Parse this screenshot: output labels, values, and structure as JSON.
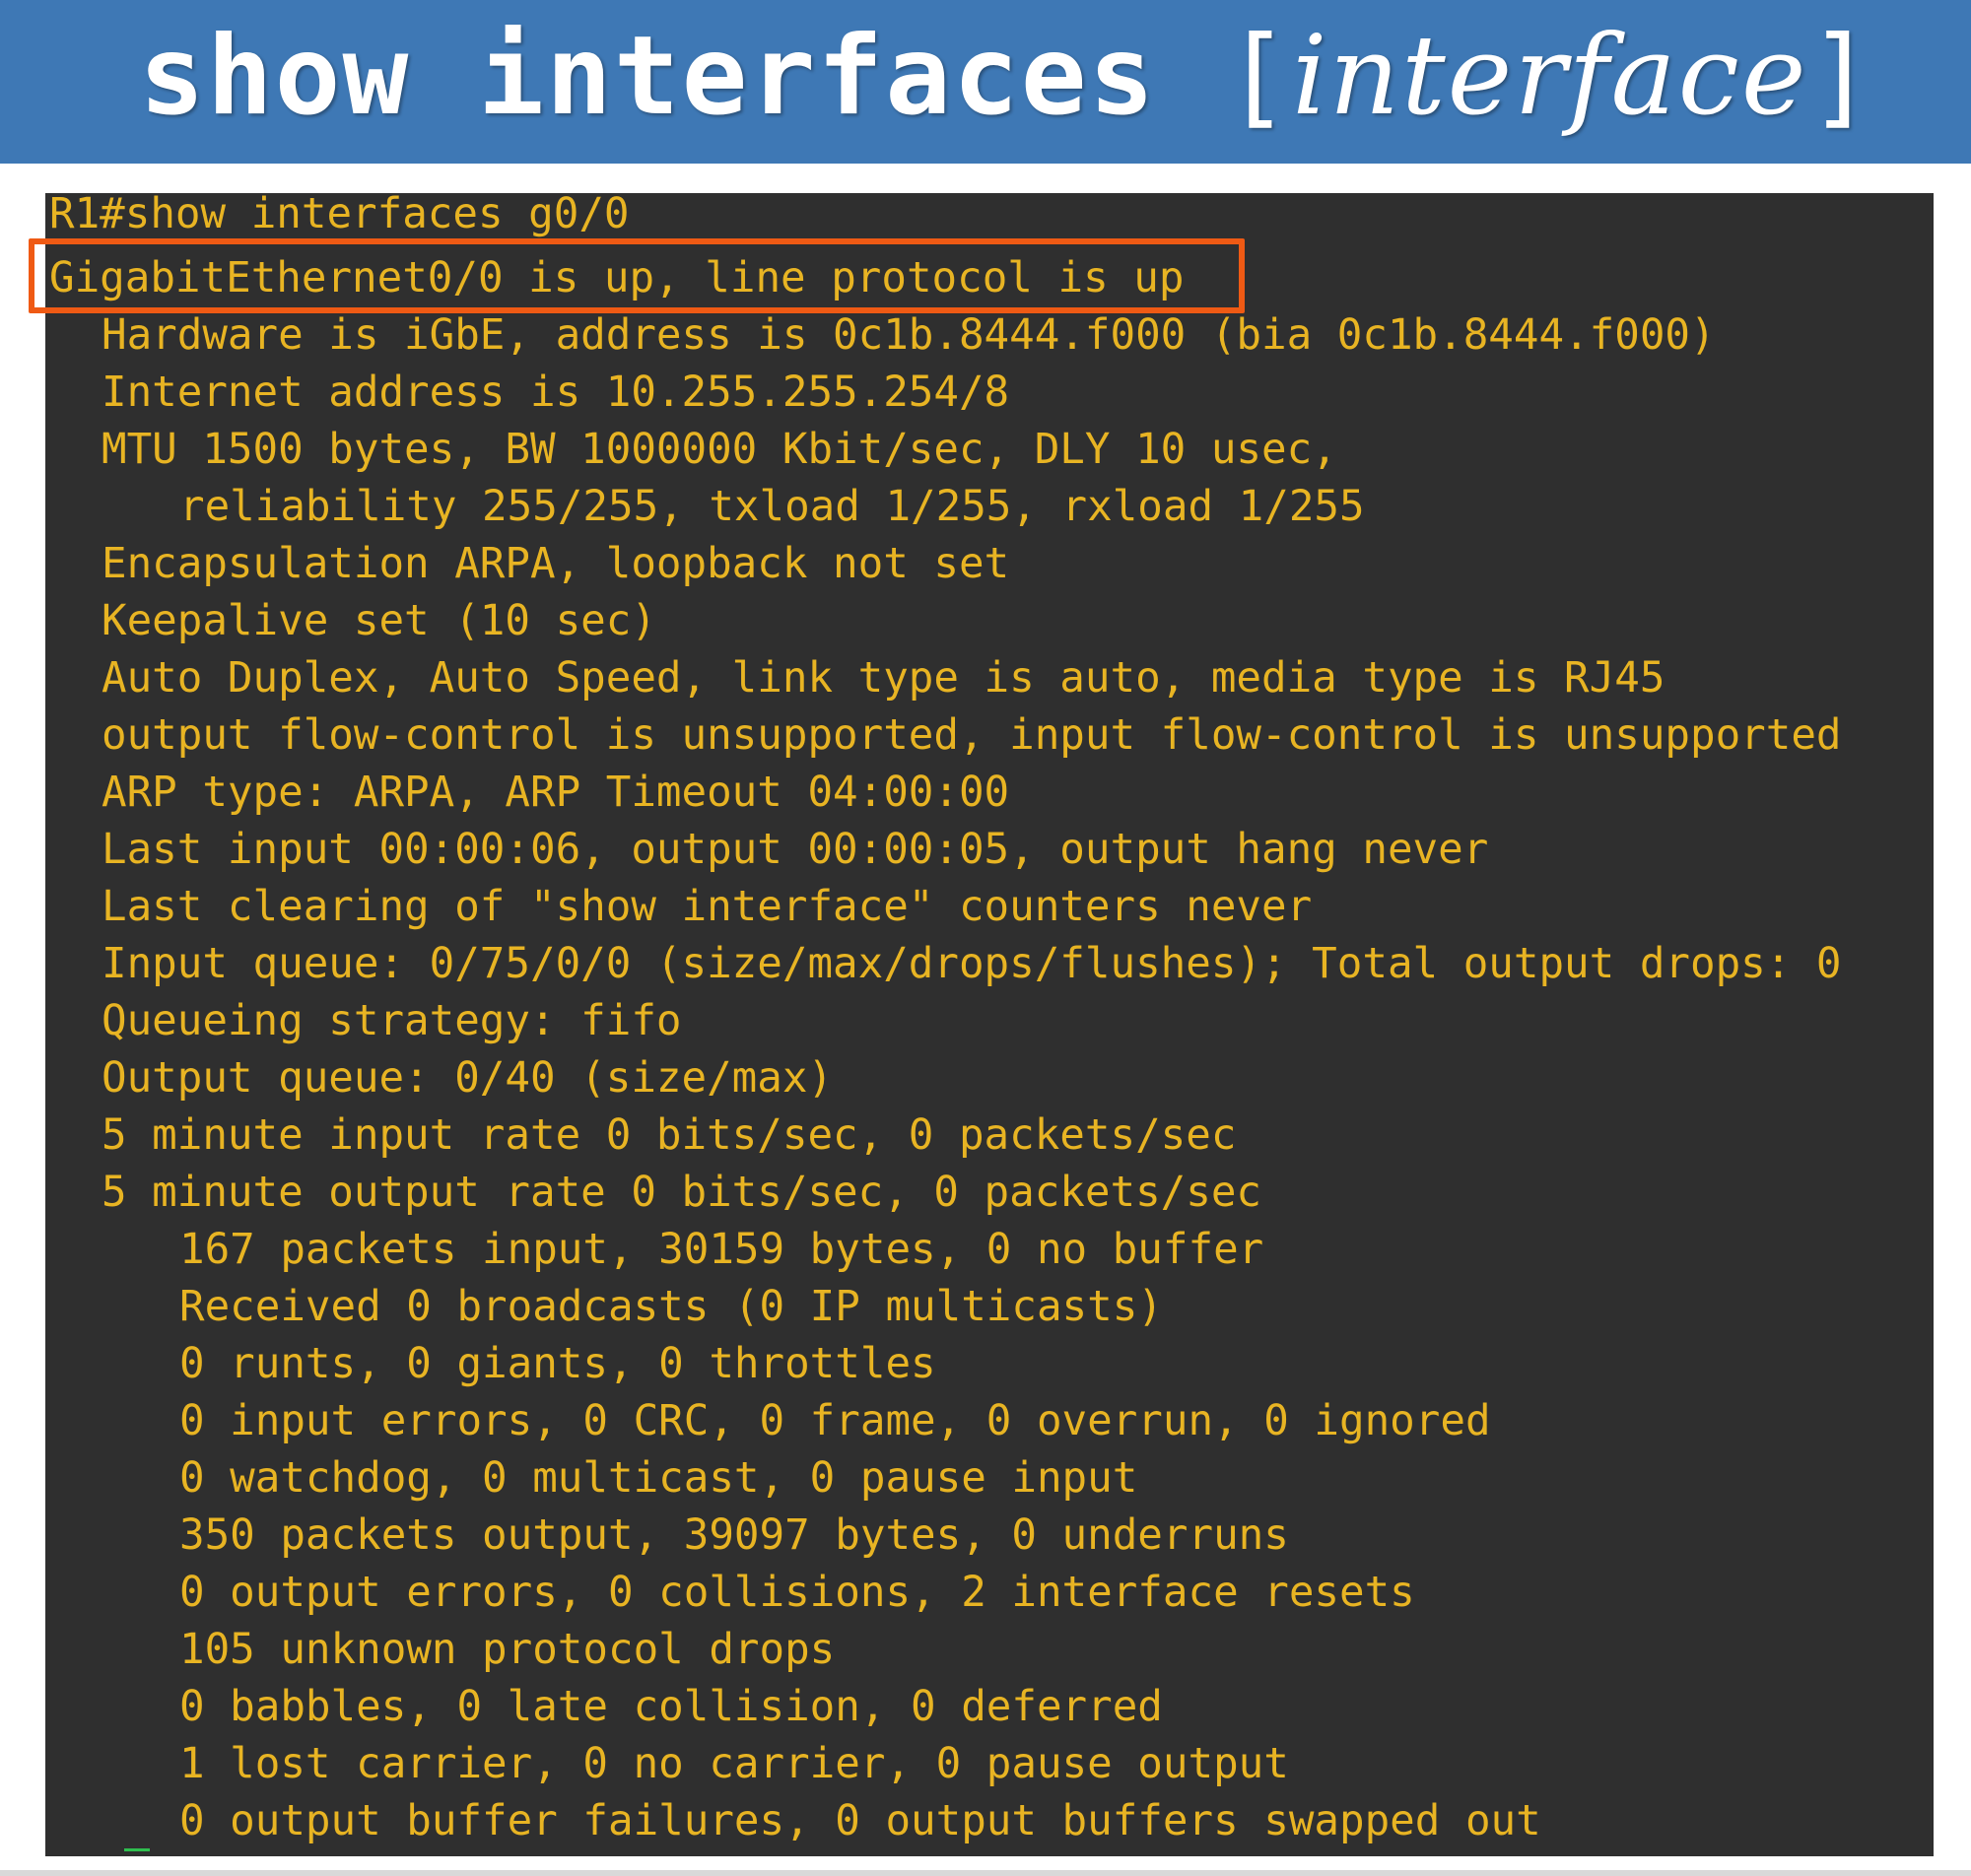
{
  "title": {
    "command": "show interfaces",
    "open_bracket": "[",
    "argument": "interface",
    "close_bracket": "]"
  },
  "colors": {
    "banner": "#3e78b5",
    "terminal_background": "#2f2f2f",
    "terminal_text": "#e8b423",
    "highlight_border": "#ef5a14"
  },
  "terminal": {
    "prompt_line": "R1#show interfaces g0/0",
    "status_line": "GigabitEthernet0/0 is up, line protocol is up",
    "hardware": "Hardware is iGbE, address is 0c1b.8444.f000 (bia 0c1b.8444.f000)",
    "internet_address": "Internet address is 10.255.255.254/8",
    "mtu": "MTU 1500 bytes, BW 1000000 Kbit/sec, DLY 10 usec,",
    "reliability": "reliability 255/255, txload 1/255, rxload 1/255",
    "encapsulation": "Encapsulation ARPA, loopback not set",
    "keepalive": "Keepalive set (10 sec)",
    "duplex": "Auto Duplex, Auto Speed, link type is auto, media type is RJ45",
    "flow_control": "output flow-control is unsupported, input flow-control is unsupported",
    "arp": "ARP type: ARPA, ARP Timeout 04:00:00",
    "last_input": "Last input 00:00:06, output 00:00:05, output hang never",
    "last_clearing": "Last clearing of \"show interface\" counters never",
    "input_queue": "Input queue: 0/75/0/0 (size/max/drops/flushes); Total output drops: 0",
    "queueing": "Queueing strategy: fifo",
    "output_queue": "Output queue: 0/40 (size/max)",
    "input_rate": "5 minute input rate 0 bits/sec, 0 packets/sec",
    "output_rate": "5 minute output rate 0 bits/sec, 0 packets/sec",
    "packets_input": "167 packets input, 30159 bytes, 0 no buffer",
    "received": "Received 0 broadcasts (0 IP multicasts)",
    "runts": "0 runts, 0 giants, 0 throttles",
    "input_errors": "0 input errors, 0 CRC, 0 frame, 0 overrun, 0 ignored",
    "watchdog": "0 watchdog, 0 multicast, 0 pause input",
    "packets_output": "350 packets output, 39097 bytes, 0 underruns",
    "output_errors": "0 output errors, 0 collisions, 2 interface resets",
    "unknown_protocol": "105 unknown protocol drops",
    "babbles": "0 babbles, 0 late collision, 0 deferred",
    "lost_carrier": "1 lost carrier, 0 no carrier, 0 pause output",
    "output_buffer": "0 output buffer failures, 0 output buffers swapped out"
  }
}
